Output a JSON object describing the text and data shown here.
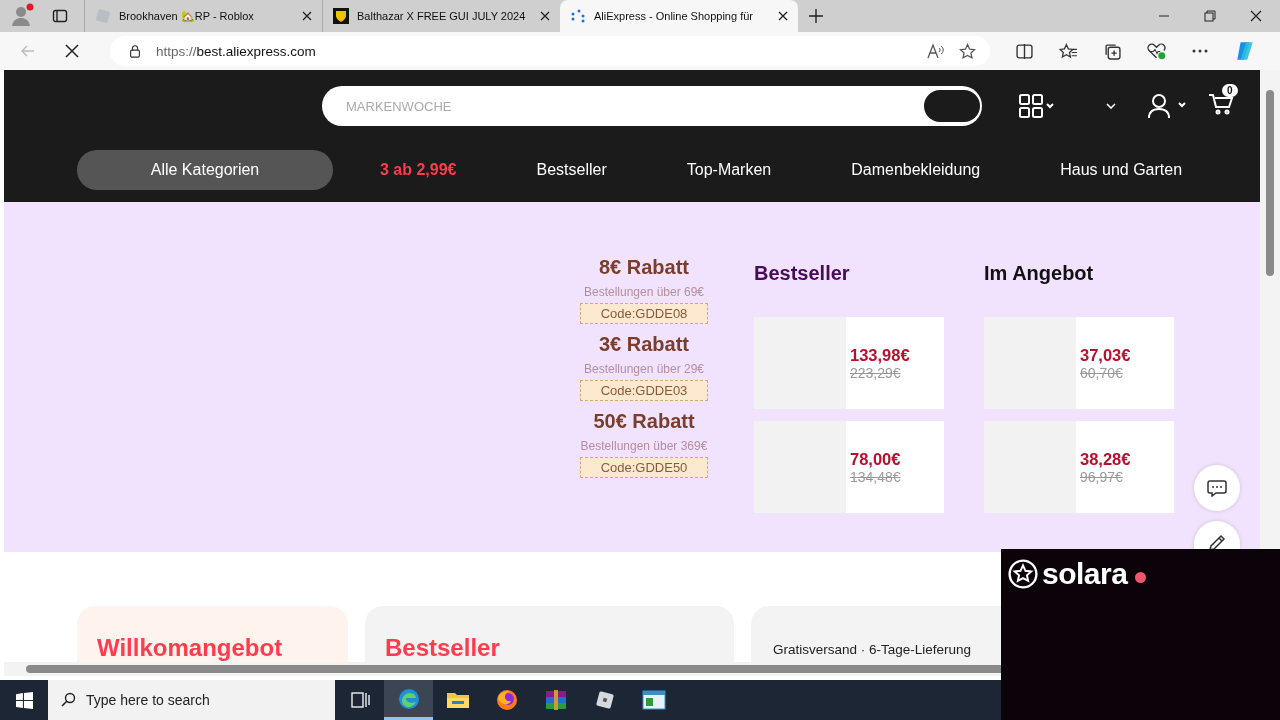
{
  "browser": {
    "tabs": [
      {
        "title": "Brookhaven 🏡RP - Roblox",
        "selected": false
      },
      {
        "title": "Balthazar X FREE GUI JULY 2024",
        "selected": false
      },
      {
        "title": "AliExpress - Online Shopping für",
        "selected": true
      }
    ],
    "url": {
      "scheme": "https://",
      "host": "best.aliexpress.com"
    }
  },
  "header": {
    "search": {
      "placeholder": "MARKENWOCHE"
    },
    "cart_count": "0"
  },
  "nav": {
    "categories": "Alle Kategorien",
    "links": [
      {
        "label": "3 ab 2,99€",
        "kind": "promo"
      },
      {
        "label": "Bestseller",
        "kind": "plain"
      },
      {
        "label": "Top-Marken",
        "kind": "plain"
      },
      {
        "label": "Damenbekleidung",
        "kind": "plain"
      },
      {
        "label": "Haus und Garten",
        "kind": "plain"
      }
    ]
  },
  "coupons": [
    {
      "title": "8€ Rabatt",
      "condition": "Bestellungen über 69€",
      "code": "Code:GDDE08"
    },
    {
      "title": "3€ Rabatt",
      "condition": "Bestellungen über 29€",
      "code": "Code:GDDE03"
    },
    {
      "title": "50€ Rabatt",
      "condition": "Bestellungen über 369€",
      "code": "Code:GDDE50"
    }
  ],
  "product_columns": [
    {
      "title": "Bestseller",
      "color": "#4a0a5a",
      "products": [
        {
          "price": "133,98€",
          "old_price": "223,29€"
        },
        {
          "price": "78,00€",
          "old_price": "134,48€"
        }
      ]
    },
    {
      "title": "Im Angebot",
      "color": "#111111",
      "products": [
        {
          "price": "37,03€",
          "old_price": "60,70€"
        },
        {
          "price": "38,28€",
          "old_price": "96,97€"
        }
      ]
    }
  ],
  "cards": [
    {
      "kind": "headline",
      "text": "Willkomangebot"
    },
    {
      "kind": "headline",
      "text": "Bestseller"
    },
    {
      "kind": "plain",
      "text": "Gratisversand · 6-Tage-Lieferung"
    }
  ],
  "taskbar": {
    "search_placeholder": "Type here to search",
    "apps": [
      {
        "selected": false
      },
      {
        "selected": true
      },
      {
        "selected": false
      },
      {
        "selected": false
      },
      {
        "selected": false
      },
      {
        "selected": false
      },
      {
        "selected": false
      }
    ]
  },
  "overlay_window": {
    "logo": "solara"
  }
}
